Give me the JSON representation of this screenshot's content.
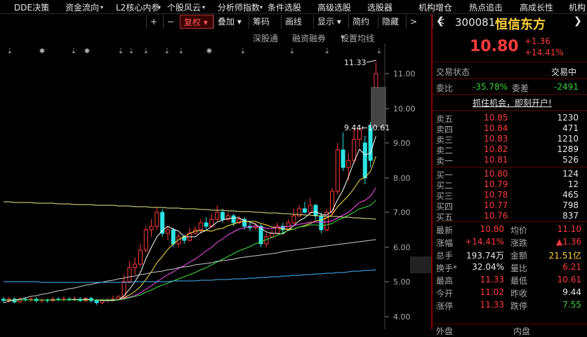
{
  "menu": {
    "items": [
      "DDE决策",
      "资金流向",
      "L2核心内参",
      "个股风云",
      "分析师指数",
      "条件选股",
      "高级选股",
      "选股器",
      "机构增仓",
      "热点追击",
      "高成长性",
      "机构"
    ]
  },
  "toolbar": {
    "plus": "+",
    "minus": "−",
    "fq": "复权",
    "overlay": "叠加",
    "chips": "筹码",
    "draw": "画线",
    "display": "显示",
    "simple": "简约",
    "hide": "隐藏",
    "next": ">",
    "prev": "<",
    "deep_link": "深股通",
    "margin": "融资融券",
    "set_ma": "设置均线"
  },
  "chart": {
    "high_label": "11.33",
    "range_label": "9.44←10.61",
    "y_ticks": [
      "11.00",
      "10.00",
      "9.00",
      "8.00",
      "7.00",
      "6.00",
      "5.00",
      "4.00"
    ],
    "markers": [
      "⇣",
      "✱",
      "⇣",
      "✱",
      "⇣",
      "⇣",
      "⇣",
      "⇣",
      "⇣",
      "✱",
      "⇣",
      "⇣",
      "⇣",
      "⇣"
    ],
    "colors": {
      "up": "#ff3b3b",
      "down": "#2fe4e4",
      "ma5": "#ffffff",
      "ma10": "#ffe14a",
      "ma20": "#ff4fff",
      "ma30": "#3cdc3c",
      "ma60": "#cccccc",
      "ma120": "#49b5ff",
      "ma250": "#e8e890"
    }
  },
  "quote": {
    "code": "300081",
    "name": "恒信东方",
    "price": "10.80",
    "change": "+1.36",
    "pct": "+14.41%",
    "status_label": "交易状态",
    "status_value": "交易中",
    "weibi_label": "委比",
    "weibi_value": "-35.78%",
    "weicha_label": "委差",
    "weicha_value": "-2491",
    "ad": "抓住机会，即刻开户!",
    "sells": [
      {
        "label": "卖五",
        "price": "10.85",
        "vol": "1230"
      },
      {
        "label": "卖四",
        "price": "10.84",
        "vol": "471"
      },
      {
        "label": "卖三",
        "price": "10.83",
        "vol": "1210"
      },
      {
        "label": "卖二",
        "price": "10.82",
        "vol": "1289"
      },
      {
        "label": "卖一",
        "price": "10.81",
        "vol": "526"
      }
    ],
    "buys": [
      {
        "label": "买一",
        "price": "10.80",
        "vol": "124"
      },
      {
        "label": "买二",
        "price": "10.79",
        "vol": "12"
      },
      {
        "label": "买三",
        "price": "10.78",
        "vol": "465"
      },
      {
        "label": "买四",
        "price": "10.77",
        "vol": "798"
      },
      {
        "label": "买五",
        "price": "10.76",
        "vol": "837"
      }
    ],
    "stats": [
      {
        "l1": "最新",
        "v1": "10.80",
        "c1": "red",
        "l2": "均价",
        "v2": "11.10",
        "c2": "red"
      },
      {
        "l1": "涨幅",
        "v1": "+14.41%",
        "c1": "red",
        "l2": "涨跌",
        "v2": "▲1.36",
        "c2": "red"
      },
      {
        "l1": "总手",
        "v1": "193.74万",
        "c1": "white",
        "l2": "金额",
        "v2": "21.51亿",
        "c2": "yellow"
      },
      {
        "l1": "换手*",
        "v1": "32.04%",
        "c1": "white",
        "l2": "量比",
        "v2": "6.21",
        "c2": "red"
      },
      {
        "l1": "最高",
        "v1": "11.33",
        "c1": "red",
        "l2": "最低",
        "v2": "10.61",
        "c2": "red"
      },
      {
        "l1": "今开",
        "v1": "11.02",
        "c1": "red",
        "l2": "昨收",
        "v2": "9.44",
        "c2": "white"
      },
      {
        "l1": "涨停",
        "v1": "11.33",
        "c1": "red",
        "l2": "跌停",
        "v2": "7.55",
        "c2": "green"
      }
    ],
    "bottom": [
      "外盘",
      "内盘"
    ]
  }
}
